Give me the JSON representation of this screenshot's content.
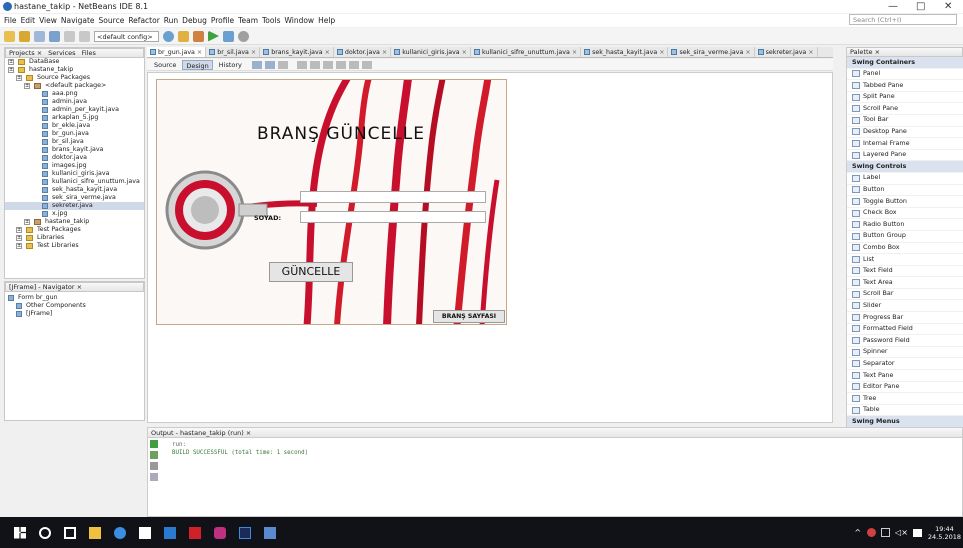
{
  "window": {
    "title": "hastane_takip - NetBeans IDE 8.1",
    "minimize": "—",
    "maximize": "□",
    "close": "✕"
  },
  "menu": [
    "File",
    "Edit",
    "View",
    "Navigate",
    "Source",
    "Refactor",
    "Run",
    "Debug",
    "Profile",
    "Team",
    "Tools",
    "Window",
    "Help"
  ],
  "search": {
    "placeholder": "Search (Ctrl+I)"
  },
  "toolbar": {
    "config": "<default config>"
  },
  "projects": {
    "tabs": [
      "Projects ×",
      "Services",
      "Files"
    ],
    "items": [
      {
        "label": "DataBase",
        "kind": "db",
        "indent": 0
      },
      {
        "label": "hastane_takip",
        "kind": "proj",
        "indent": 0
      },
      {
        "label": "Source Packages",
        "kind": "folder",
        "indent": 1
      },
      {
        "label": "<default package>",
        "kind": "pkg",
        "indent": 2
      },
      {
        "label": "aaa.png",
        "kind": "file",
        "indent": 3
      },
      {
        "label": "admin.java",
        "kind": "file",
        "indent": 3
      },
      {
        "label": "admin_per_kayit.java",
        "kind": "file",
        "indent": 3
      },
      {
        "label": "arkaplan_5.jpg",
        "kind": "file",
        "indent": 3
      },
      {
        "label": "br_ekle.java",
        "kind": "file",
        "indent": 3
      },
      {
        "label": "br_gun.java",
        "kind": "file",
        "indent": 3
      },
      {
        "label": "br_sil.java",
        "kind": "file",
        "indent": 3
      },
      {
        "label": "brans_kayit.java",
        "kind": "file",
        "indent": 3
      },
      {
        "label": "doktor.java",
        "kind": "file",
        "indent": 3
      },
      {
        "label": "images.jpg",
        "kind": "file",
        "indent": 3
      },
      {
        "label": "kullanici_giris.java",
        "kind": "file",
        "indent": 3
      },
      {
        "label": "kullanici_sifre_unuttum.java",
        "kind": "file",
        "indent": 3
      },
      {
        "label": "sek_hasta_kayit.java",
        "kind": "file",
        "indent": 3
      },
      {
        "label": "sek_sira_verme.java",
        "kind": "file",
        "indent": 3
      },
      {
        "label": "sekreter.java",
        "kind": "file",
        "indent": 3,
        "selected": true
      },
      {
        "label": "x.jpg",
        "kind": "file",
        "indent": 3
      },
      {
        "label": "hastane_takip",
        "kind": "pkg",
        "indent": 2
      },
      {
        "label": "Test Packages",
        "kind": "folder",
        "indent": 1
      },
      {
        "label": "Libraries",
        "kind": "folder",
        "indent": 1
      },
      {
        "label": "Test Libraries",
        "kind": "folder",
        "indent": 1
      }
    ]
  },
  "navigator": {
    "title": "[JFrame] - Navigator ×",
    "items": [
      {
        "label": "Form br_gun",
        "indent": 0
      },
      {
        "label": "Other Components",
        "indent": 1
      },
      {
        "label": "[JFrame]",
        "indent": 1
      }
    ]
  },
  "editor": {
    "tabs": [
      "br_gun.java",
      "br_sil.java",
      "brans_kayit.java",
      "doktor.java",
      "kullanici_giris.java",
      "kullanici_sifre_unuttum.java",
      "sek_hasta_kayit.java",
      "sek_sira_verme.java",
      "sekreter.java"
    ],
    "views": [
      "Source",
      "Design",
      "History"
    ]
  },
  "form": {
    "title": "BRANŞ GÜNCELLE",
    "field_label": "SOYAD:",
    "button": "GÜNCELLE",
    "back_button": "BRANŞ SAYFASI"
  },
  "palette": {
    "title": "Palette ×",
    "items": [
      {
        "label": "Swing Containers",
        "header": true
      },
      {
        "label": "Panel"
      },
      {
        "label": "Tabbed Pane"
      },
      {
        "label": "Split Pane"
      },
      {
        "label": "Scroll Pane"
      },
      {
        "label": "Tool Bar"
      },
      {
        "label": "Desktop Pane"
      },
      {
        "label": "Internal Frame"
      },
      {
        "label": "Layered Pane"
      },
      {
        "label": "Swing Controls",
        "header": true
      },
      {
        "label": "Label"
      },
      {
        "label": "Button"
      },
      {
        "label": "Toggle Button"
      },
      {
        "label": "Check Box"
      },
      {
        "label": "Radio Button"
      },
      {
        "label": "Button Group"
      },
      {
        "label": "Combo Box"
      },
      {
        "label": "List"
      },
      {
        "label": "Text Field"
      },
      {
        "label": "Text Area"
      },
      {
        "label": "Scroll Bar"
      },
      {
        "label": "Slider"
      },
      {
        "label": "Progress Bar"
      },
      {
        "label": "Formatted Field"
      },
      {
        "label": "Password Field"
      },
      {
        "label": "Spinner"
      },
      {
        "label": "Separator"
      },
      {
        "label": "Text Pane"
      },
      {
        "label": "Editor Pane"
      },
      {
        "label": "Tree"
      },
      {
        "label": "Table"
      },
      {
        "label": "Swing Menus",
        "header": true
      }
    ]
  },
  "output": {
    "title": "Output - hastane_takip (run) ×",
    "lines": [
      "run:",
      "BUILD SUCCESSFUL (total time: 1 second)"
    ]
  },
  "taskbar": {
    "time": "19:44",
    "date": "24.5.2018"
  },
  "colors": {
    "accent": "#c8102e",
    "selection": "#cfd9e8",
    "taskbar": "#101218"
  }
}
